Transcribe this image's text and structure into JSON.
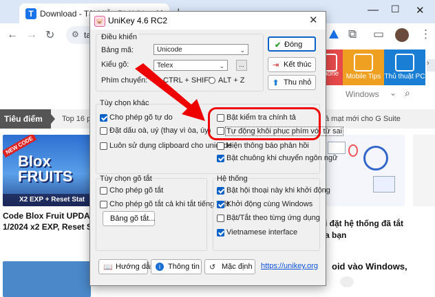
{
  "browser": {
    "tab_title": "Download - Tải Miễn Phí VN",
    "tab_favicon": "T",
    "address_fragment": "ta"
  },
  "site": {
    "categories": [
      "hone",
      "Mobile Tips",
      "Thủ thuật PC"
    ],
    "category_colors": [
      "#e5494a",
      "#f0a020",
      "#1a7fd4"
    ],
    "search_placeholder": "Windows",
    "topnav_label": "Tiêu điểm",
    "topnav_item": "Top 16 ph",
    "topnav_right": "ả mạt mới cho G Suite",
    "article_left_title": "Code Blox Fruit UPDATE t",
    "article_left_sub": "1/2024 x2 EXP, Reset Stat,",
    "thumb_caption": "X2 EXP + Reset Stat",
    "thumb_badge": "NEW CODE",
    "thumb_logo": "Blox FRUITS",
    "article_right_title": "i đặt hệ thống đã tắt",
    "article_right_sub": "a bạn",
    "article_right_2": "oid vào Windows,"
  },
  "dialog": {
    "title": "UniKey 4.6 RC2",
    "control_group": "Điều khiển",
    "bang_ma_label": "Bảng mã:",
    "bang_ma_value": "Unicode",
    "kieu_go_label": "Kiểu gõ:",
    "kieu_go_value": "Telex",
    "ellipsis": "...",
    "phim_chuyen_label": "Phím chuyển:",
    "radio_ctrl_shift": "CTRL + SHIFT",
    "radio_alt_z": "ALT + Z",
    "btn_dong": "Đóng",
    "btn_ket_thuc": "Kết thúc",
    "btn_thu_nho": "Thu nhỏ",
    "options_group": "Tùy chọn khác",
    "opt_cho_phep_go_tu_do": "Cho phép gõ tự do",
    "opt_dat_dau": "Đặt dấu oà, uý (thay vì òa, úy)",
    "opt_clipboard": "Luôn sử dụng clipboard cho unicode",
    "opt_bat_kiem_tra": "Bật kiểm tra chính tả",
    "opt_tu_dong_khoi_phuc": "Tự động khôi phục phím với từ sai",
    "opt_hien_thong_bao": "Hiện thông báo phản hồi",
    "opt_bat_chuong": "Bật chuông khi chuyển ngôn ngữ",
    "shortcut_group": "Tùy chọn gõ tắt",
    "opt_cho_phep_go_tat": "Cho phép gõ tắt",
    "opt_go_tat_khi_tat": "Cho phép gõ tắt cả khi tắt tiếng Việt",
    "btn_bang_go_tat": "Bảng gõ tắt...",
    "system_group": "Hệ thống",
    "sys_hoi_thoai": "Bật hội thoại này khi khởi động",
    "sys_khoi_dong": "Khởi động cùng Windows",
    "sys_bat_tat": "Bật/Tắt theo từng ứng dụng",
    "sys_vn_interface": "Vietnamese interface",
    "btn_huong_dan": "Hướng dẫn",
    "btn_thong_tin": "Thông tin",
    "btn_mac_dinh": "Mặc định",
    "link": "https://unikey.org"
  },
  "colors": {
    "accent": "#0a62c7",
    "annotation": "#e00000",
    "link": "#0a50d8"
  }
}
